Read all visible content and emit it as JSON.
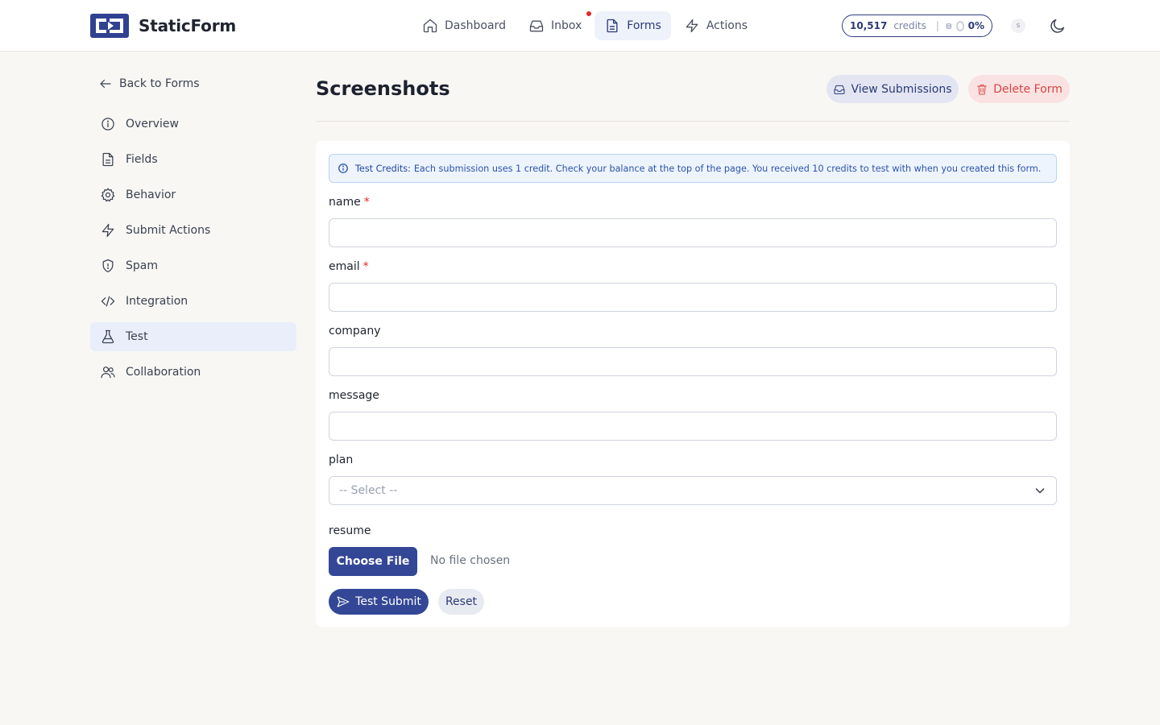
{
  "app": {
    "name": "StaticForm"
  },
  "nav": {
    "items": [
      {
        "label": "Dashboard",
        "icon": "home-icon"
      },
      {
        "label": "Inbox",
        "icon": "inbox-icon",
        "has_notification": true
      },
      {
        "label": "Forms",
        "icon": "file-icon",
        "active": true
      },
      {
        "label": "Actions",
        "icon": "lightning-icon"
      }
    ]
  },
  "credits": {
    "amount": "10,517",
    "label": "credits",
    "separator": "|",
    "usage_percent": "0%"
  },
  "user": {
    "avatar_initial": "s"
  },
  "sidebar": {
    "back_label": "Back to Forms",
    "items": [
      {
        "label": "Overview",
        "icon": "info-icon"
      },
      {
        "label": "Fields",
        "icon": "file-icon"
      },
      {
        "label": "Behavior",
        "icon": "gear-icon"
      },
      {
        "label": "Submit Actions",
        "icon": "lightning-icon"
      },
      {
        "label": "Spam",
        "icon": "shield-icon"
      },
      {
        "label": "Integration",
        "icon": "code-icon"
      },
      {
        "label": "Test",
        "icon": "flask-icon",
        "active": true
      },
      {
        "label": "Collaboration",
        "icon": "users-icon"
      }
    ]
  },
  "page": {
    "title": "Screenshots",
    "view_submissions_label": "View Submissions",
    "delete_form_label": "Delete Form"
  },
  "info_banner": {
    "title": "Test Credits:",
    "text": "Each submission uses 1 credit. Check your balance at the top of the page. You received 10 credits to test with when you created this form."
  },
  "form": {
    "fields": [
      {
        "label": "name",
        "required": true,
        "value": ""
      },
      {
        "label": "email",
        "required": true,
        "value": ""
      },
      {
        "label": "company",
        "required": false,
        "value": ""
      },
      {
        "label": "message",
        "required": false,
        "value": ""
      }
    ],
    "required_marker": "*",
    "plan": {
      "label": "plan",
      "selected": "-- Select --"
    },
    "resume": {
      "label": "resume",
      "button_label": "Choose File",
      "status": "No file chosen"
    },
    "submit_label": "Test Submit",
    "reset_label": "Reset"
  },
  "colors": {
    "primary": "#334796",
    "danger": "#d64545",
    "background": "#f8f7f4",
    "notification_dot": "#e5242a"
  }
}
